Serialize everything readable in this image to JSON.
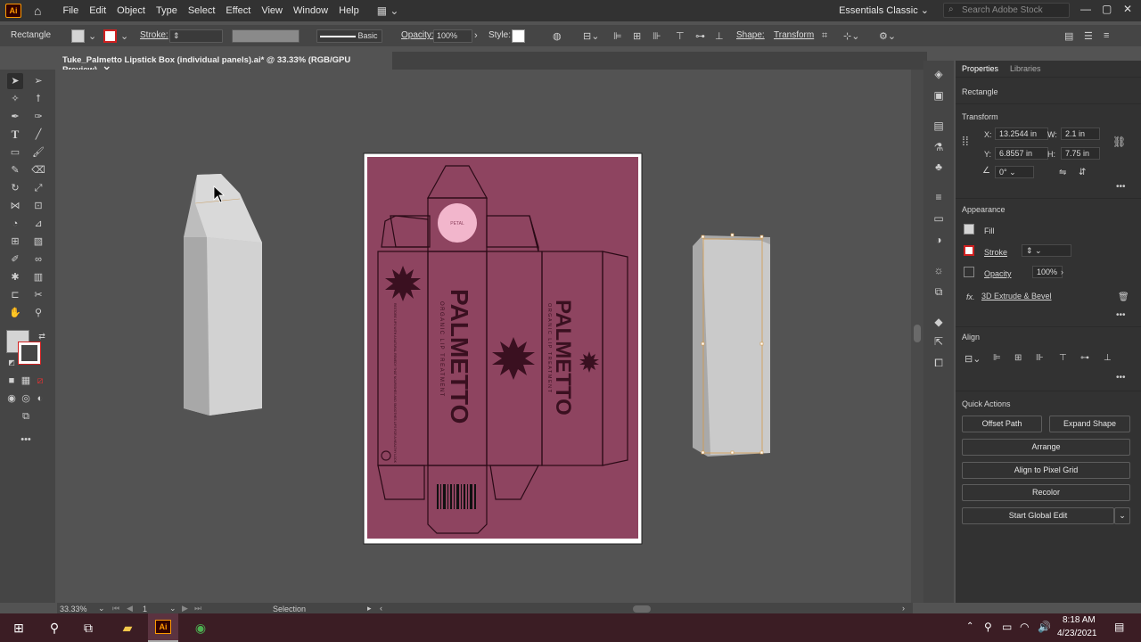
{
  "app": {
    "logo_text": "Ai",
    "menu": [
      "File",
      "Edit",
      "Object",
      "Type",
      "Select",
      "Effect",
      "View",
      "Window",
      "Help"
    ],
    "workspace": "Essentials Classic",
    "search_placeholder": "Search Adobe Stock"
  },
  "control_bar": {
    "object_type": "Rectangle",
    "stroke_label": "Stroke:",
    "brush": "Basic",
    "opacity_label": "Opacity:",
    "opacity_value": "100%",
    "style_label": "Style:",
    "shape_label": "Shape:",
    "transform_label": "Transform"
  },
  "document": {
    "tab_title": "Tuke_Palmetto Lipstick Box (individual panels).ai* @ 33.33% (RGB/GPU Preview)",
    "close": "✕"
  },
  "artwork": {
    "badge": "PETAL",
    "brand_1": "PALMETTO",
    "tagline_1": "ORGANIC LIP TREATMENT",
    "brand_2": "PALMETTO",
    "tagline_2": "ORGANIC LIP TREATMENT",
    "side_text": "RESTORE LIPS WITH A NATURAL REMEDY THAT NOURISHES AND SMOOTHES LIPS FOR A HEALTHY LOOK",
    "colors": {
      "box": "#8e4460",
      "ink": "#3a1020",
      "badge": "#f2b6cc"
    }
  },
  "properties": {
    "tabs": [
      "Properties",
      "Libraries"
    ],
    "selection": "Rectangle",
    "transform": {
      "title": "Transform",
      "x_label": "X:",
      "x": "13.2544 in",
      "y_label": "Y:",
      "y": "6.8557 in",
      "w_label": "W:",
      "w": "2.1 in",
      "h_label": "H:",
      "h": "7.75 in",
      "angle": "0°"
    },
    "appearance": {
      "title": "Appearance",
      "fill": "Fill",
      "stroke": "Stroke",
      "opacity_label": "Opacity",
      "opacity": "100%",
      "effect": "3D Extrude & Bevel",
      "fx": "fx."
    },
    "align_title": "Align",
    "quick_actions": {
      "title": "Quick Actions",
      "offset_path": "Offset Path",
      "expand_shape": "Expand Shape",
      "arrange": "Arrange",
      "align_pixel": "Align to Pixel Grid",
      "recolor": "Recolor",
      "global_edit": "Start Global Edit"
    }
  },
  "status": {
    "zoom": "33.33%",
    "artboard": "1",
    "tool": "Selection"
  },
  "taskbar": {
    "time": "8:18 AM",
    "date": "4/23/2021"
  }
}
